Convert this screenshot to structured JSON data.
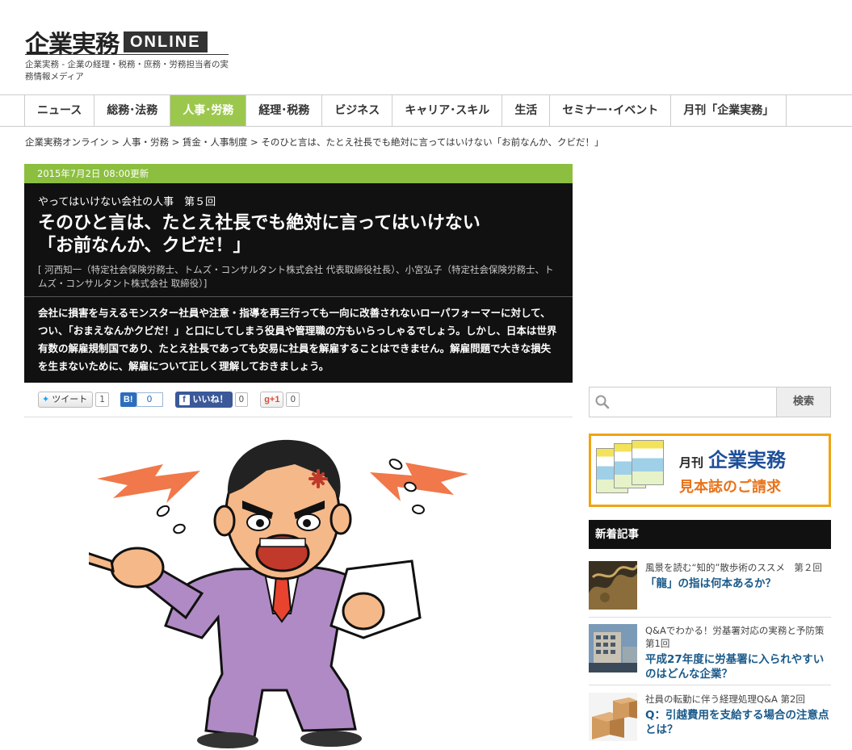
{
  "header": {
    "logo_jp": "企業実務",
    "logo_online": "ONLINE",
    "tagline": "企業実務 - 企業の経理・税務・庶務・労務担当者の実務情報メディア"
  },
  "nav": {
    "items": [
      "ニュース",
      "総務･法務",
      "人事･労務",
      "経理･税務",
      "ビジネス",
      "キャリア･スキル",
      "生活",
      "セミナー･イベント",
      "月刊「企業実務」"
    ],
    "active_index": 2,
    "active_color": "#9cc74d"
  },
  "breadcrumb": "企業実務オンライン > 人事・労務 > 賃金・人事制度 > そのひと言は、たとえ社長でも絶対に言ってはいけない「お前なんか、クビだ！」",
  "article": {
    "date": "2015年7月2日 08:00更新",
    "series": "やってはいけない会社の人事　第５回",
    "title_line1": "そのひと言は、たとえ社長でも絶対に言ってはいけない",
    "title_line2": "「お前なんか、クビだ！」",
    "authors": "[ 河西知一（特定社会保険労務士、トムズ・コンサルタント株式会社 代表取締役社長）、小宮弘子（特定社会保険労務士、トムズ・コンサルタント株式会社 取締役）]",
    "lead": "会社に損害を与えるモンスター社員や注意・指導を再三行っても一向に改善されないローパフォーマーに対して、つい、「おまえなんかクビだ！」と口にしてしまう役員や管理職の方もいらっしゃるでしょう。しかし、日本は世界有数の解雇規制国であり、たとえ社長であっても安易に社員を解雇することはできません。解雇問題で大きな損失を生まないために、解雇について正しく理解しておきましょう。"
  },
  "social": {
    "tweet_label": "ツイート",
    "tweet_count": "1",
    "hatena_label": "B!",
    "hatena_count": "0",
    "fb_label": "いいね！",
    "fb_count": "0",
    "gplus_label": "g+1",
    "gplus_count": "0"
  },
  "sidebar": {
    "search_button": "検索",
    "banner_monthly": "月刊",
    "banner_name": "企業実務",
    "banner_sub": "見本誌のご請求",
    "new_head": "新着記事",
    "news": [
      {
        "series": "風景を読む“知的”散歩術のススメ　第２回",
        "title": "「龍」の指は何本あるか？"
      },
      {
        "series": "Q&Aでわかる！労基署対応の実務と予防策　第1回",
        "title": "平成27年度に労基署に入られやすいのはどんな企業？"
      },
      {
        "series": "社員の転勤に伴う経理処理Q&A 第2回",
        "title": "Q：引越費用を支給する場合の注意点とは？"
      }
    ]
  }
}
